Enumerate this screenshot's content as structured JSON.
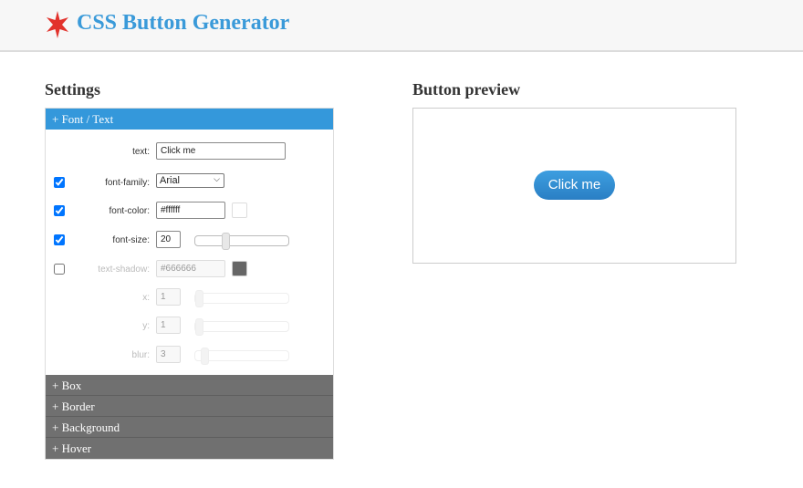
{
  "header": {
    "title": "CSS Button Generator",
    "logo": "red-star-icon"
  },
  "settings": {
    "heading": "Settings",
    "sections": [
      {
        "label": "+ Font / Text",
        "active": true
      },
      {
        "label": "+ Box"
      },
      {
        "label": "+ Border"
      },
      {
        "label": "+ Background"
      },
      {
        "label": "+ Hover"
      }
    ],
    "font": {
      "text": {
        "label": "text:",
        "value": "Click me"
      },
      "font_family": {
        "label": "font-family:",
        "value": "Arial",
        "checked": true
      },
      "font_color": {
        "label": "font-color:",
        "value": "#ffffff",
        "checked": true,
        "swatch": "#ffffff"
      },
      "font_size": {
        "label": "font-size:",
        "value": "20",
        "checked": true
      },
      "text_shadow": {
        "label": "text-shadow:",
        "value": "#666666",
        "checked": false,
        "swatch": "#666666"
      },
      "x": {
        "label": "x:",
        "value": "1"
      },
      "y": {
        "label": "y:",
        "value": "1"
      },
      "blur": {
        "label": "blur:",
        "value": "3"
      }
    }
  },
  "preview": {
    "heading": "Button preview",
    "button_label": "Click me",
    "button_color": "#3498db"
  }
}
